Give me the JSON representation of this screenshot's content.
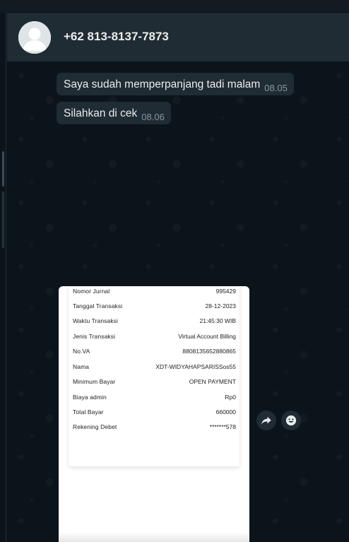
{
  "header": {
    "contact_name": "+62 813-8137-7873"
  },
  "messages": [
    {
      "text": "Saya sudah memperpanjang tadi malam",
      "time": "08.05"
    },
    {
      "text": "Silahkan di cek",
      "time": "08.06"
    }
  ],
  "receipt": {
    "rows": [
      {
        "label": "Nomor Jurnal",
        "value": "995429"
      },
      {
        "label": "Tanggal Transaksi",
        "value": "28-12-2023"
      },
      {
        "label": "Waktu Transaksi",
        "value": "21:45:30 WIB"
      },
      {
        "label": "Jenis Transaksi",
        "value": "Virtual Account Billing"
      },
      {
        "label": "No.VA",
        "value": "8808135652880865"
      },
      {
        "label": "Nama",
        "value": "XDT-WIDYAHAPSARISSos55"
      },
      {
        "label": "Minimum Bayar",
        "value": "OPEN PAYMENT"
      },
      {
        "label": "Biaya admin",
        "value": "Rp0"
      },
      {
        "label": "Total Bayar",
        "value": "660000"
      },
      {
        "label": "Rekening Debet",
        "value": "*******578"
      }
    ]
  },
  "icons": {
    "avatar": "default-avatar-icon",
    "forward": "forward-arrow-icon",
    "emoji": "smiley-face-icon"
  },
  "colors": {
    "chat_background": "#0b141a",
    "header_background": "#202c33",
    "bubble_background": "#202c33",
    "text_primary": "#e9edef",
    "text_secondary": "#8696a0"
  }
}
